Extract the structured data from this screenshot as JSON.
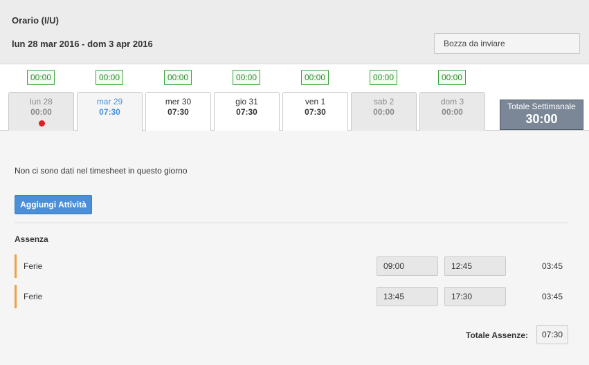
{
  "header": {
    "title": "Orario (I/U)",
    "period": "lun 28 mar 2016 - dom 3 apr 2016",
    "status": "Bozza da inviare"
  },
  "days": [
    {
      "badge": "00:00",
      "name": "lun 28",
      "hours": "00:00",
      "state": "inactive",
      "alert": true
    },
    {
      "badge": "00:00",
      "name": "mar 29",
      "hours": "07:30",
      "state": "active",
      "alert": false
    },
    {
      "badge": "00:00",
      "name": "mer 30",
      "hours": "07:30",
      "state": "workday",
      "alert": false
    },
    {
      "badge": "00:00",
      "name": "gio 31",
      "hours": "07:30",
      "state": "workday",
      "alert": false
    },
    {
      "badge": "00:00",
      "name": "ven 1",
      "hours": "07:30",
      "state": "workday",
      "alert": false
    },
    {
      "badge": "00:00",
      "name": "sab 2",
      "hours": "00:00",
      "state": "inactive",
      "alert": false
    },
    {
      "badge": "00:00",
      "name": "dom 3",
      "hours": "00:00",
      "state": "inactive",
      "alert": false
    }
  ],
  "weekly_total": {
    "label": "Totale Settimanale",
    "value": "30:00"
  },
  "content": {
    "empty_message": "Non ci sono dati nel timesheet in questo giorno",
    "add_button": "Aggiungi Attività"
  },
  "absence": {
    "title": "Assenza",
    "rows": [
      {
        "name": "Ferie",
        "start": "09:00",
        "end": "12:45",
        "duration": "03:45"
      },
      {
        "name": "Ferie",
        "start": "13:45",
        "end": "17:30",
        "duration": "03:45"
      }
    ],
    "total_label": "Totale Assenze:",
    "total_value": "07:30"
  },
  "colors": {
    "accent_blue": "#4a90d9",
    "badge_green": "#3aa23a",
    "absence_bar": "#f0a040",
    "alert_red": "#e02020",
    "weekly_total_bg": "#7b8797"
  }
}
